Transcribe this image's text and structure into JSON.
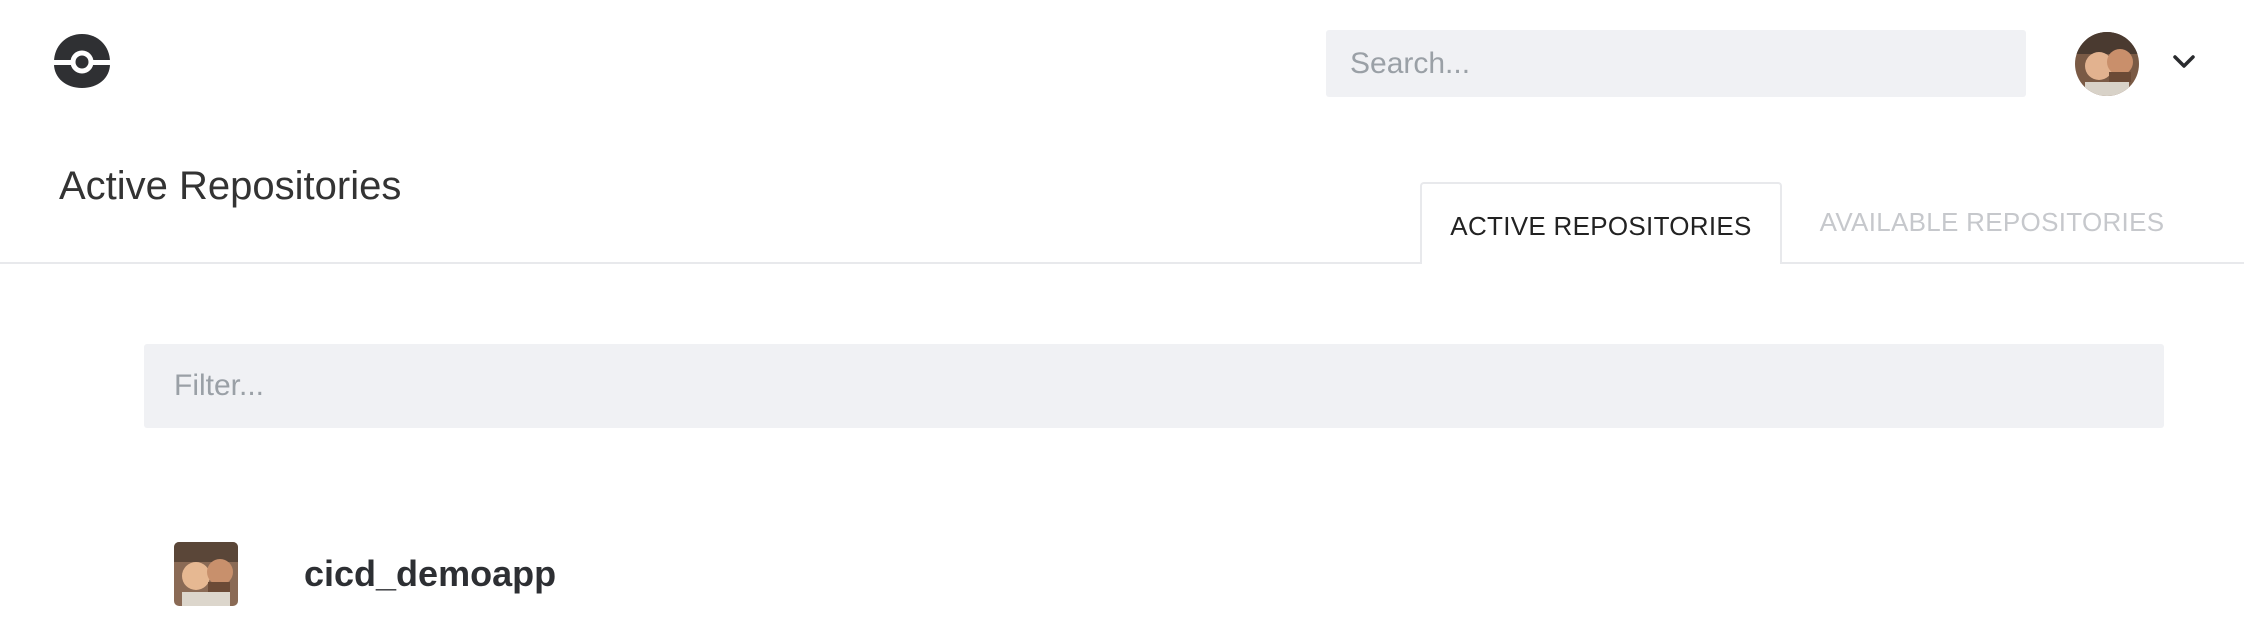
{
  "header": {
    "logo_icon": "drone-logo-icon",
    "search": {
      "placeholder": "Search...",
      "value": ""
    },
    "user_avatar_icon": "user-avatar",
    "menu_icon": "chevron-down-icon"
  },
  "page": {
    "title": "Active Repositories"
  },
  "tabs": [
    {
      "label": "ACTIVE REPOSITORIES",
      "active": true
    },
    {
      "label": "AVAILABLE REPOSITORIES",
      "active": false
    }
  ],
  "filter": {
    "placeholder": "Filter...",
    "value": ""
  },
  "repositories": [
    {
      "name": "cicd_demoapp",
      "avatar_icon": "repo-avatar"
    }
  ],
  "colors": {
    "input_bg": "#f0f1f4",
    "text": "#333333",
    "tab_inactive": "#c6c8cc",
    "divider": "#e8e9ec"
  }
}
